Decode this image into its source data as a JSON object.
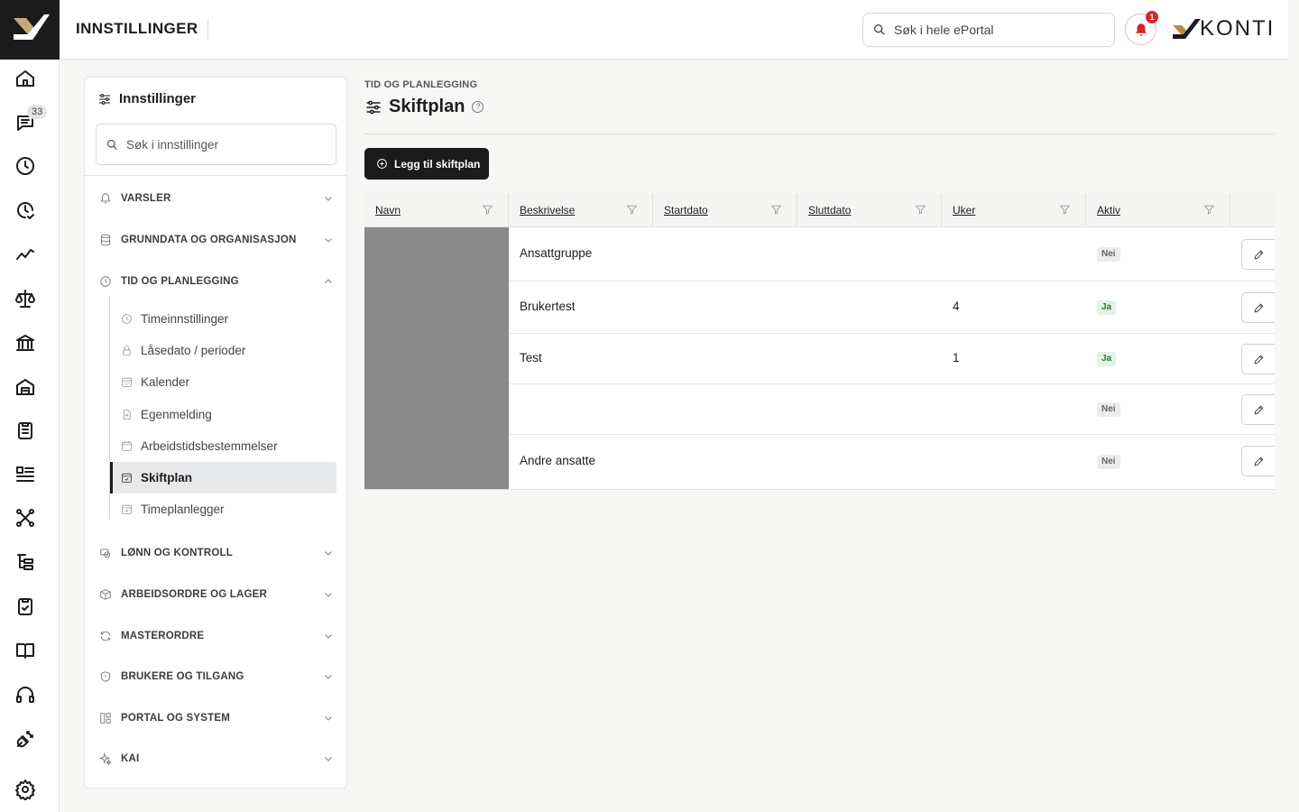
{
  "app": {
    "header_title": "INNSTILLINGER",
    "search_placeholder": "Søk i hele ePortal",
    "notification_count": "1",
    "brand_name": "KONTI"
  },
  "rail": {
    "messages_badge": "33",
    "icons": [
      "home-icon",
      "chat-icon",
      "clock-icon",
      "time-check-icon",
      "trend-icon",
      "scale-icon",
      "bank-icon",
      "building-icon",
      "clipboard-icon",
      "list-icon",
      "network-icon",
      "tree-icon",
      "checklist-icon",
      "book-icon",
      "headset-icon",
      "plug-icon",
      "settings-gear-icon"
    ]
  },
  "settings": {
    "title": "Innstillinger",
    "search_placeholder": "Søk i innstillinger",
    "sections": [
      {
        "label": "VARSLER",
        "icon": "bell-icon",
        "expanded": false
      },
      {
        "label": "GRUNNDATA OG ORGANISASJON",
        "icon": "database-icon",
        "expanded": false
      },
      {
        "label": "TID OG PLANLEGGING",
        "icon": "clock-icon",
        "expanded": true
      },
      {
        "label": "LØNN OG KONTROLL",
        "icon": "money-icon",
        "expanded": false
      },
      {
        "label": "ARBEIDSORDRE OG LAGER",
        "icon": "box-icon",
        "expanded": false
      },
      {
        "label": "MASTERORDRE",
        "icon": "refresh-icon",
        "expanded": false
      },
      {
        "label": "BRUKERE OG TILGANG",
        "icon": "shield-icon",
        "expanded": false
      },
      {
        "label": "PORTAL OG SYSTEM",
        "icon": "layout-icon",
        "expanded": false
      },
      {
        "label": "KAI",
        "icon": "sparkle-icon",
        "expanded": false
      }
    ],
    "sub_items": [
      {
        "label": "Timeinnstillinger",
        "icon": "clock-icon",
        "active": false
      },
      {
        "label": "Låsedato / perioder",
        "icon": "lock-icon",
        "active": false
      },
      {
        "label": "Kalender",
        "icon": "calendar-grid-icon",
        "active": false
      },
      {
        "label": "Egenmelding",
        "icon": "document-icon",
        "active": false
      },
      {
        "label": "Arbeidstidsbestemmelser",
        "icon": "calendar-icon",
        "active": false
      },
      {
        "label": "Skiftplan",
        "icon": "calendar-check-icon",
        "active": true
      },
      {
        "label": "Timeplanlegger",
        "icon": "calendar-plus-icon",
        "active": false
      }
    ]
  },
  "main": {
    "breadcrumb": "TID OG PLANLEGGING",
    "title": "Skiftplan",
    "help": "?",
    "add_button": "Legg til skiftplan",
    "columns": [
      "Navn",
      "Beskrivelse",
      "Startdato",
      "Sluttdato",
      "Uker",
      "Aktiv"
    ],
    "rows": [
      {
        "navn": "",
        "beskrivelse": "Ansattgruppe",
        "startdato": "",
        "sluttdato": "",
        "uker": "",
        "aktiv": "Nei",
        "active": false
      },
      {
        "navn": "",
        "beskrivelse": "Brukertest",
        "startdato": "",
        "sluttdato": "",
        "uker": "4",
        "aktiv": "Ja",
        "active": true
      },
      {
        "navn": "",
        "beskrivelse": "Test",
        "startdato": "",
        "sluttdato": "",
        "uker": "1",
        "aktiv": "Ja",
        "active": true
      },
      {
        "navn": "",
        "beskrivelse": "",
        "startdato": "",
        "sluttdato": "",
        "uker": "",
        "aktiv": "Nei",
        "active": false
      },
      {
        "navn": "",
        "beskrivelse": "Andre ansatte",
        "startdato": "",
        "sluttdato": "",
        "uker": "",
        "aktiv": "Nei",
        "active": false
      }
    ]
  },
  "colors": {
    "accent_dark": "#1b1b1b",
    "notification_red": "#d7262b",
    "active_green": "#1f7a35",
    "brand_gold": "#b88a4a"
  }
}
